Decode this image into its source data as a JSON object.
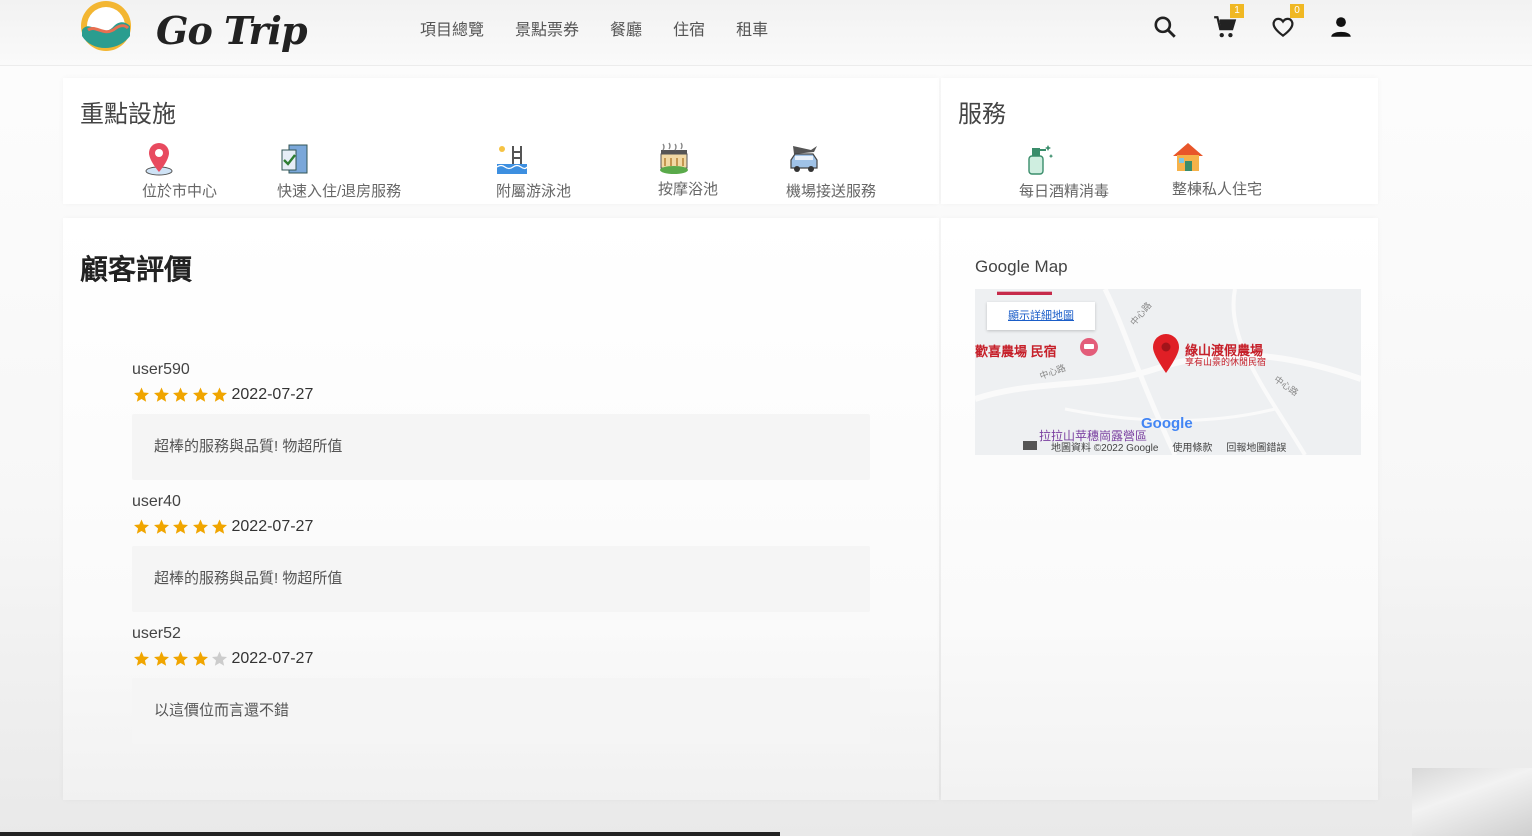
{
  "brand": {
    "name": "Go Trip"
  },
  "nav": [
    "項目總覽",
    "景點票券",
    "餐廳",
    "住宿",
    "租車"
  ],
  "header_icons": {
    "search": "search-icon",
    "cart": {
      "icon": "cart-icon",
      "count": "1"
    },
    "favorites": {
      "icon": "heart-icon",
      "count": "0"
    },
    "account": "user-icon"
  },
  "facilities": {
    "title": "重點設施",
    "items": [
      {
        "label": "位於市中心",
        "icon": "map-pin-icon"
      },
      {
        "label": "快速入住/退房服務",
        "icon": "checkin-door-icon"
      },
      {
        "label": "附屬游泳池",
        "icon": "swimming-pool-icon"
      },
      {
        "label": "按摩浴池",
        "icon": "hot-tub-icon"
      },
      {
        "label": "機場接送服務",
        "icon": "airport-shuttle-icon"
      }
    ]
  },
  "services": {
    "title": "服務",
    "items": [
      {
        "label": "每日酒精消毒",
        "icon": "disinfect-spray-icon"
      },
      {
        "label": "整棟私人住宅",
        "icon": "house-icon"
      }
    ]
  },
  "reviews": {
    "title": "顧客評價",
    "items": [
      {
        "user": "user590",
        "rating": 5,
        "date": "2022-07-27",
        "comment": "超棒的服務與品質! 物超所值"
      },
      {
        "user": "user40",
        "rating": 5,
        "date": "2022-07-27",
        "comment": "超棒的服務與品質! 物超所值"
      },
      {
        "user": "user52",
        "rating": 4,
        "date": "2022-07-27",
        "comment": "以這價位而言還不錯"
      }
    ]
  },
  "map": {
    "label": "Google Map",
    "link_text": "顯示詳細地圖",
    "place_name": "綠山渡假農場",
    "place_sub": "享有山景的休閒民宿",
    "poi_left": "歡喜農場 民宿",
    "poi_bottom": "拉拉山苹穗崗露營區",
    "road_labels": [
      "中心路",
      "中心路",
      "中心路"
    ],
    "brand": "Google",
    "footer": [
      "地圖資料 ©2022 Google",
      "使用條款",
      "回報地圖錯誤"
    ]
  },
  "colors": {
    "star": "#f0a500",
    "star_empty": "#cccccc",
    "badge": "#f0b823",
    "pin": "#e01f26"
  }
}
